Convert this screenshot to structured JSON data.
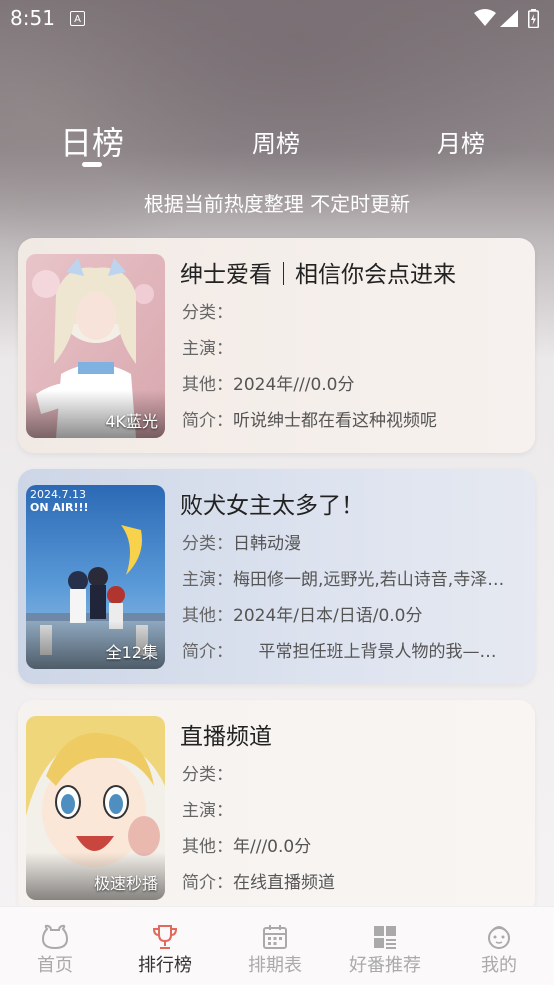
{
  "status_bar": {
    "time": "8:51",
    "notification_icon": "A"
  },
  "tabs": [
    {
      "label": "日榜",
      "active": true
    },
    {
      "label": "周榜",
      "active": false
    },
    {
      "label": "月榜",
      "active": false
    }
  ],
  "subtitle": "根据当前热度整理 不定时更新",
  "labels": {
    "category": "分类：",
    "cast": "主演：",
    "other": "其他：",
    "intro": "简介："
  },
  "items": [
    {
      "title": "绅士爱看｜相信你会点进来",
      "badge": "4K蓝光",
      "category": "",
      "cast": "",
      "other": "2024年///0.0分",
      "intro": "听说绅士都在看这种视频呢"
    },
    {
      "title": "败犬女主太多了！",
      "badge": "全12集",
      "poster_text": "2024.7.13 ON AIR!!!",
      "category": "日韩动漫",
      "cast": "梅田修一朗,远野光,若山诗音,寺泽…",
      "other": "2024年/日本/日语/0.0分",
      "intro": "　　平常担任班上背景人物的我—…"
    },
    {
      "title": "直播频道",
      "badge": "极速秒播",
      "category": "",
      "cast": "",
      "other": "年///0.0分",
      "intro": "在线直播频道"
    }
  ],
  "bottom_nav": [
    {
      "label": "首页",
      "icon": "home-bear-icon",
      "active": false
    },
    {
      "label": "排行榜",
      "icon": "trophy-icon",
      "active": true
    },
    {
      "label": "排期表",
      "icon": "calendar-icon",
      "active": false
    },
    {
      "label": "好番推荐",
      "icon": "grid-icon",
      "active": false
    },
    {
      "label": "我的",
      "icon": "face-icon",
      "active": false
    }
  ],
  "colors": {
    "active_nav": "#e06a5c",
    "inactive_nav": "#aaaaaa"
  }
}
